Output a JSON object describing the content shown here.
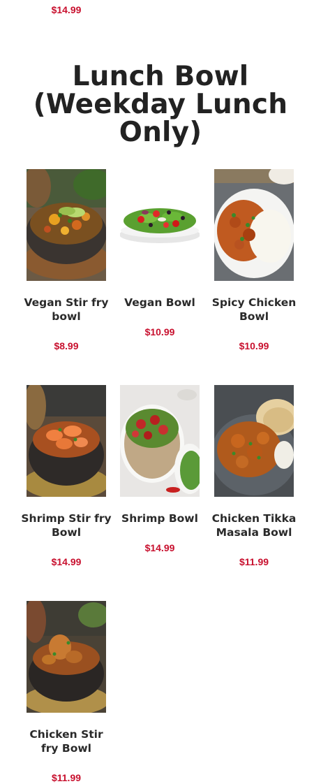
{
  "top_item": {
    "price": "$14.99"
  },
  "section": {
    "title": "Lunch Bowl (Weekday Lunch Only)"
  },
  "items": [
    {
      "name": "Vegan Stir fry bowl",
      "price": "$8.99",
      "icon": "vegan-stir-fry-bowl-photo"
    },
    {
      "name": "Vegan Bowl",
      "price": "$10.99",
      "icon": "vegan-salad-bowl-photo"
    },
    {
      "name": "Spicy Chicken Bowl",
      "price": "$10.99",
      "icon": "spicy-chicken-rice-bowl-photo"
    },
    {
      "name": "Shrimp Stir fry Bowl",
      "price": "$14.99",
      "icon": "shrimp-stir-fry-bowl-photo"
    },
    {
      "name": "Shrimp Bowl",
      "price": "$14.99",
      "icon": "shrimp-grain-bowl-photo"
    },
    {
      "name": "Chicken Tikka Masala Bowl",
      "price": "$11.99",
      "icon": "chicken-tikka-masala-photo"
    },
    {
      "name": "Chicken Stir fry Bowl",
      "price": "$11.99",
      "icon": "chicken-stir-fry-bowl-photo"
    }
  ],
  "colors": {
    "price": "#c8102e",
    "title": "#222222",
    "background": "#ffffff"
  }
}
